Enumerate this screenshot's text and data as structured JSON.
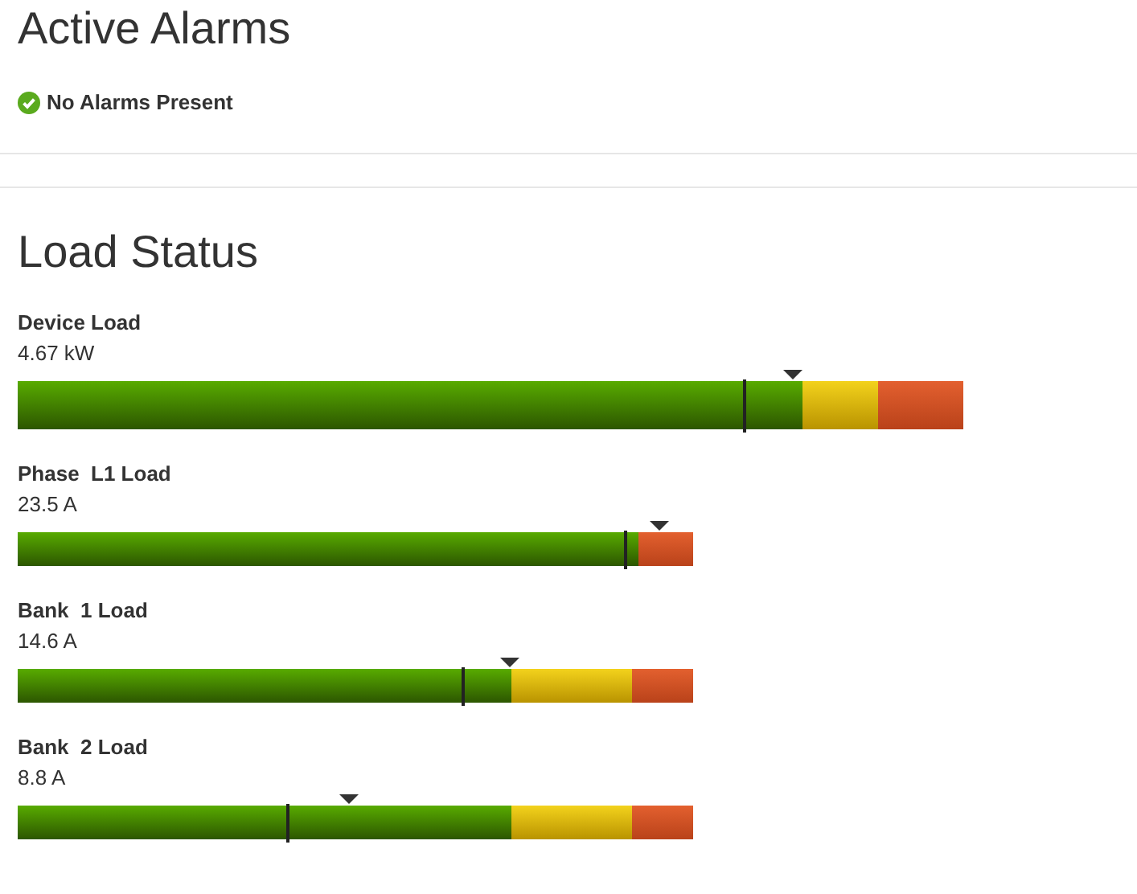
{
  "alarms": {
    "title": "Active Alarms",
    "status": {
      "kind": "ok",
      "text": "No Alarms Present"
    }
  },
  "load_status": {
    "title": "Load Status",
    "gauges": [
      {
        "kind": "device",
        "label": "Device Load",
        "reading": "4.67 kW",
        "level": 0.769,
        "marker": {
          "level": 0.82
        },
        "zones": [
          {
            "kind": "warning",
            "level": 0.91
          },
          {
            "kind": "normal",
            "level": 0.83
          }
        ]
      },
      {
        "kind": "phase",
        "label": "Phase  L1 Load",
        "reading": "23.5 A",
        "level": 0.9,
        "marker": {
          "level": 0.95
        },
        "zones": [
          {
            "kind": "normal",
            "level": 0.919
          }
        ]
      },
      {
        "kind": "bank",
        "label": "Bank  1 Load",
        "reading": "14.6 A",
        "level": 0.66,
        "marker": {
          "level": 0.729
        },
        "zones": [
          {
            "kind": "warning",
            "level": 0.91
          },
          {
            "kind": "normal",
            "level": 0.731
          }
        ]
      },
      {
        "kind": "bank",
        "label": "Bank  2 Load",
        "reading": "8.8 A",
        "level": 0.4,
        "marker": {
          "level": 0.49
        },
        "zones": [
          {
            "kind": "warning",
            "level": 0.91
          },
          {
            "kind": "normal",
            "level": 0.731
          }
        ]
      }
    ]
  }
}
